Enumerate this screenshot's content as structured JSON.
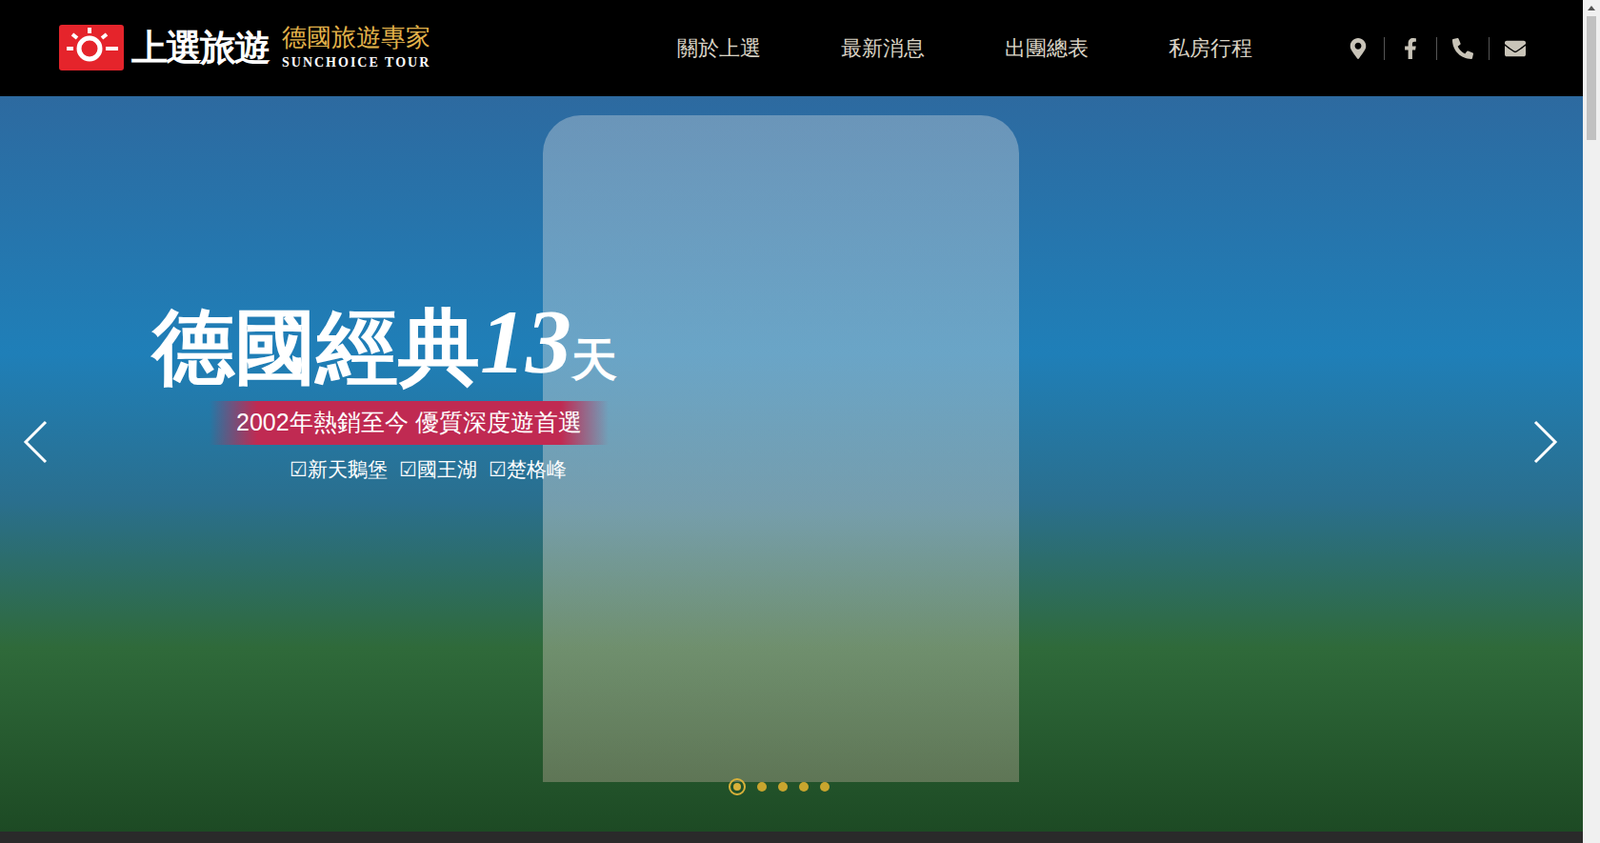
{
  "header": {
    "logo": {
      "brand": "上選旅遊",
      "tagline": "德國旅遊專家",
      "english": "SUNCHOICE TOUR"
    },
    "nav": [
      {
        "label": "關於上選"
      },
      {
        "label": "最新消息"
      },
      {
        "label": "出團總表"
      },
      {
        "label": "私房行程"
      }
    ]
  },
  "hero": {
    "title": "德國經典",
    "days": "13",
    "unit": "天",
    "subtitle": "2002年熱銷至今 優質深度遊首選",
    "tags": [
      {
        "mark": "☑",
        "label": "新天鵝堡"
      },
      {
        "mark": "☑",
        "label": "國王湖"
      },
      {
        "mark": "☑",
        "label": "楚格峰"
      }
    ],
    "dots": [
      {
        "selected": true
      },
      {
        "selected": false
      },
      {
        "selected": false
      },
      {
        "selected": false
      },
      {
        "selected": false
      }
    ]
  }
}
